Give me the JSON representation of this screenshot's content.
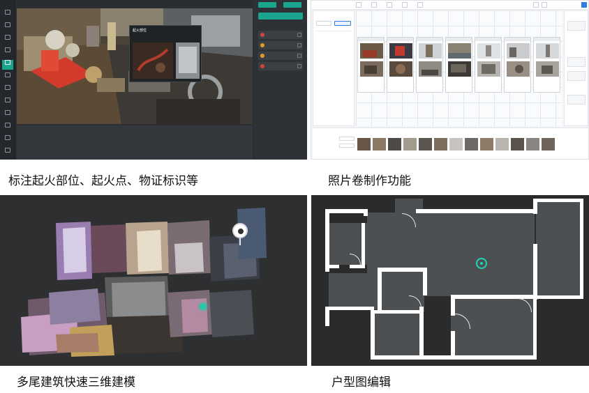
{
  "captions": {
    "p1": "标注起火部位、起火点、物证标识等",
    "p2": "照片卷制作功能",
    "p3": "多尾建筑快速三维建模",
    "p4": "户型图编辑"
  },
  "p1": {
    "popup_title": "起火部位",
    "colors": {
      "accent": "#1aa68e",
      "bg": "#2b2f33"
    }
  },
  "icons": [
    "panel-icon",
    "marker-icon",
    "location-icon",
    "door-icon"
  ],
  "p4": {
    "colors": {
      "wall": "#ffffff",
      "floor": "#4c5052",
      "marker": "#1fd6b4"
    }
  }
}
